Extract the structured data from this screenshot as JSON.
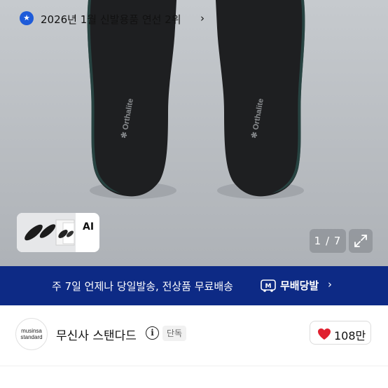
{
  "gallery": {
    "product_logo_text": "Orthalite",
    "thumb_label": "AI",
    "thumb_chevron": "›",
    "counter": "1 / 7",
    "expand_icon": "expand-icon"
  },
  "banner": {
    "text": "주 7일 언제나 당일발송, 전상품 무료배송",
    "brand_icon": "truck-logo-icon",
    "brand": "무배당발",
    "chevron": "›",
    "color": "#0d2a85"
  },
  "brand": {
    "logo_line1": "musinsa",
    "logo_line2": "standard",
    "name": "무신사 스탠다드",
    "info_icon": "i",
    "badge": "단독",
    "likes": "108만",
    "heart_color": "#e0202f"
  },
  "ranking": {
    "icon": "★",
    "text": "2026년 1월 신발용품 연선 2위",
    "chevron": "›",
    "accent": "#1e5bd9"
  }
}
